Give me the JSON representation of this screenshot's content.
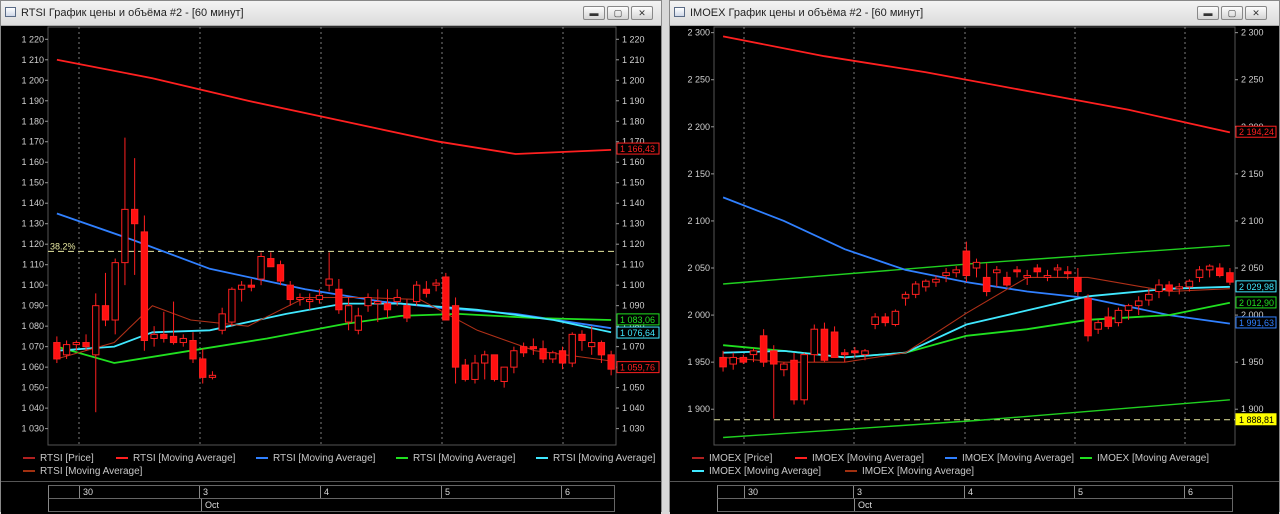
{
  "windows": [
    {
      "id": "rtsi",
      "title": "RTSI График цены и объёма #2 - [60 минут]",
      "y_ticks": [
        "1 220",
        "1 210",
        "1 200",
        "1 190",
        "1 180",
        "1 170",
        "1 160",
        "1 150",
        "1 140",
        "1 130",
        "1 120",
        "1 110",
        "1 100",
        "1 090",
        "1 080",
        "1 070",
        "1 060",
        "1 050",
        "1 040",
        "1 030"
      ],
      "y_range": [
        1022,
        1226
      ],
      "fib_label": "38.2%",
      "fib_value": 1116.5,
      "price_labels": [
        {
          "text": "1 166,43",
          "value": 1166.43,
          "color": "#ff2020"
        },
        {
          "text": "1 083,06",
          "value": 1083.06,
          "color": "#20e020"
        },
        {
          "text": "1 076,64",
          "value": 1076.64,
          "color": "#40e8ff"
        },
        {
          "text": "1 059,76",
          "value": 1059.76,
          "color": "#ff2020"
        }
      ],
      "legend": [
        {
          "label": "RTSI [Price]",
          "color": "#b02020"
        },
        {
          "label": "RTSI [Moving Average]",
          "color": "#ff2020"
        },
        {
          "label": "RTSI [Moving Average]",
          "color": "#3080ff"
        },
        {
          "label": "RTSI [Moving Average]",
          "color": "#20e020"
        },
        {
          "label": "RTSI [Moving Average]",
          "color": "#40e8ff"
        },
        {
          "label": "RTSI [Moving Average]",
          "color": "#a03010"
        }
      ],
      "x_days": [
        "30",
        "3",
        "4",
        "5",
        "6"
      ],
      "x_month": "Oct",
      "series": {
        "candles": [
          [
            1072,
            1075,
            1062,
            1064
          ],
          [
            1066,
            1073,
            1064,
            1071
          ],
          [
            1071,
            1073,
            1068,
            1072
          ],
          [
            1072,
            1076,
            1068,
            1070
          ],
          [
            1066,
            1096,
            1038,
            1090
          ],
          [
            1090,
            1106,
            1080,
            1083
          ],
          [
            1083,
            1113,
            1076,
            1111
          ],
          [
            1111,
            1172,
            1100,
            1137
          ],
          [
            1137,
            1162,
            1105,
            1130
          ],
          [
            1126,
            1134,
            1068,
            1073
          ],
          [
            1074,
            1080,
            1070,
            1076
          ],
          [
            1076,
            1087,
            1072,
            1074
          ],
          [
            1075,
            1092,
            1071,
            1072
          ],
          [
            1072,
            1076,
            1070,
            1074
          ],
          [
            1073,
            1077,
            1062,
            1064
          ],
          [
            1064,
            1069,
            1052,
            1055
          ],
          [
            1055,
            1058,
            1054,
            1056
          ],
          [
            1078,
            1089,
            1076,
            1086
          ],
          [
            1082,
            1099,
            1080,
            1098
          ],
          [
            1098,
            1102,
            1092,
            1100
          ],
          [
            1100,
            1103,
            1097,
            1099
          ],
          [
            1103,
            1116,
            1100,
            1114
          ],
          [
            1113,
            1116,
            1109,
            1109
          ],
          [
            1110,
            1112,
            1100,
            1102
          ],
          [
            1100,
            1102,
            1090,
            1093
          ],
          [
            1093,
            1096,
            1090,
            1094
          ],
          [
            1092,
            1096,
            1088,
            1093
          ],
          [
            1093,
            1098,
            1091,
            1095
          ],
          [
            1100,
            1116,
            1097,
            1103
          ],
          [
            1098,
            1103,
            1086,
            1088
          ],
          [
            1082,
            1094,
            1078,
            1090
          ],
          [
            1078,
            1089,
            1076,
            1085
          ],
          [
            1090,
            1096,
            1087,
            1094
          ],
          [
            1091,
            1098,
            1082,
            1092
          ],
          [
            1091,
            1098,
            1084,
            1088
          ],
          [
            1092,
            1098,
            1090,
            1094
          ],
          [
            1090,
            1093,
            1082,
            1084
          ],
          [
            1092,
            1102,
            1090,
            1100
          ],
          [
            1098,
            1102,
            1094,
            1096
          ],
          [
            1100,
            1103,
            1097,
            1101
          ],
          [
            1104,
            1106,
            1084,
            1083
          ],
          [
            1090,
            1094,
            1052,
            1060
          ],
          [
            1061,
            1064,
            1053,
            1054
          ],
          [
            1054,
            1066,
            1052,
            1062
          ],
          [
            1062,
            1068,
            1054,
            1066
          ],
          [
            1066,
            1066,
            1053,
            1054
          ],
          [
            1053,
            1058,
            1050,
            1060
          ],
          [
            1060,
            1070,
            1057,
            1068
          ],
          [
            1070,
            1072,
            1065,
            1067
          ],
          [
            1070,
            1074,
            1066,
            1069
          ],
          [
            1069,
            1073,
            1062,
            1064
          ],
          [
            1064,
            1068,
            1062,
            1067
          ],
          [
            1068,
            1070,
            1059,
            1062
          ],
          [
            1062,
            1077,
            1060,
            1076
          ],
          [
            1076,
            1078,
            1068,
            1073
          ],
          [
            1070,
            1080,
            1066,
            1072
          ],
          [
            1072,
            1073,
            1062,
            1066
          ],
          [
            1066,
            1068,
            1056,
            1059
          ]
        ],
        "ma_red": [
          [
            0,
            1210
          ],
          [
            10,
            1201
          ],
          [
            20,
            1190
          ],
          [
            30,
            1180
          ],
          [
            40,
            1170
          ],
          [
            48,
            1164
          ],
          [
            58,
            1166
          ]
        ],
        "ma_blue": [
          [
            0,
            1135
          ],
          [
            8,
            1122
          ],
          [
            16,
            1108
          ],
          [
            26,
            1098
          ],
          [
            34,
            1092
          ],
          [
            40,
            1089
          ],
          [
            48,
            1086
          ],
          [
            58,
            1079
          ]
        ],
        "ma_green": [
          [
            0,
            1070
          ],
          [
            6,
            1062
          ],
          [
            14,
            1068
          ],
          [
            22,
            1074
          ],
          [
            30,
            1081
          ],
          [
            36,
            1085
          ],
          [
            42,
            1086
          ],
          [
            50,
            1084
          ],
          [
            58,
            1083
          ]
        ],
        "ma_cyan": [
          [
            0,
            1068
          ],
          [
            6,
            1070
          ],
          [
            10,
            1077
          ],
          [
            16,
            1078
          ],
          [
            24,
            1086
          ],
          [
            30,
            1091
          ],
          [
            36,
            1091
          ],
          [
            44,
            1088
          ],
          [
            52,
            1083
          ],
          [
            58,
            1077
          ]
        ],
        "ma_dark": [
          [
            0,
            1064
          ],
          [
            6,
            1072
          ],
          [
            10,
            1090
          ],
          [
            14,
            1083
          ],
          [
            20,
            1080
          ],
          [
            26,
            1094
          ],
          [
            32,
            1094
          ],
          [
            38,
            1093
          ],
          [
            44,
            1078
          ],
          [
            50,
            1068
          ],
          [
            58,
            1063
          ]
        ]
      }
    },
    {
      "id": "imoex",
      "title": "IMOEX График цены и объёма #2 - [60 минут]",
      "y_ticks": [
        "2 300",
        "2 250",
        "2 200",
        "2 150",
        "2 100",
        "2 050",
        "2 000",
        "1 950",
        "1 900"
      ],
      "y_range": [
        1862,
        2306
      ],
      "fib_label": "",
      "fib_value": 1888.81,
      "price_labels": [
        {
          "text": "2 194,24",
          "value": 2194.24,
          "color": "#ff2020"
        },
        {
          "text": "2 029,98",
          "value": 2029.98,
          "color": "#40e8ff"
        },
        {
          "text": "2 012,90",
          "value": 2012.9,
          "color": "#20e020"
        },
        {
          "text": "1 991,63",
          "value": 1991.63,
          "color": "#3080ff"
        },
        {
          "text": "1 888,81",
          "value": 1888.81,
          "color": "#ffff00"
        }
      ],
      "legend": [
        {
          "label": "IMOEX [Price]",
          "color": "#b02020"
        },
        {
          "label": "IMOEX [Moving Average]",
          "color": "#ff2020"
        },
        {
          "label": "IMOEX [Moving Average]",
          "color": "#3080ff"
        },
        {
          "label": "IMOEX [Moving Average]",
          "color": "#20e020"
        },
        {
          "label": "IMOEX [Moving Average]",
          "color": "#40e8ff"
        },
        {
          "label": "IMOEX [Moving Average]",
          "color": "#a03010"
        }
      ],
      "x_days": [
        "30",
        "3",
        "4",
        "5",
        "6"
      ],
      "x_month": "Oct",
      "series": {
        "candles": [
          [
            1955,
            1962,
            1940,
            1945
          ],
          [
            1948,
            1960,
            1942,
            1955
          ],
          [
            1955,
            1958,
            1948,
            1950
          ],
          [
            1958,
            1965,
            1950,
            1962
          ],
          [
            1978,
            1985,
            1945,
            1950
          ],
          [
            1962,
            1968,
            1890,
            1948
          ],
          [
            1942,
            1950,
            1935,
            1948
          ],
          [
            1952,
            1960,
            1905,
            1910
          ],
          [
            1910,
            1960,
            1905,
            1958
          ],
          [
            1958,
            1990,
            1950,
            1985
          ],
          [
            1985,
            1992,
            1950,
            1952
          ],
          [
            1982,
            1988,
            1955,
            1955
          ],
          [
            1960,
            1964,
            1950,
            1958
          ],
          [
            1962,
            1966,
            1955,
            1960
          ],
          [
            1958,
            1964,
            1952,
            1962
          ],
          [
            1990,
            2002,
            1985,
            1998
          ],
          [
            1998,
            2002,
            1988,
            1992
          ],
          [
            1990,
            2006,
            1988,
            2004
          ],
          [
            2018,
            2025,
            2010,
            2022
          ],
          [
            2022,
            2036,
            2018,
            2033
          ],
          [
            2030,
            2038,
            2025,
            2036
          ],
          [
            2035,
            2042,
            2030,
            2038
          ],
          [
            2042,
            2050,
            2035,
            2045
          ],
          [
            2045,
            2052,
            2040,
            2048
          ],
          [
            2068,
            2078,
            2035,
            2042
          ],
          [
            2050,
            2060,
            2040,
            2056
          ],
          [
            2040,
            2055,
            2020,
            2025
          ],
          [
            2045,
            2052,
            2030,
            2048
          ],
          [
            2040,
            2046,
            2030,
            2032
          ],
          [
            2048,
            2052,
            2040,
            2046
          ],
          [
            2040,
            2048,
            2032,
            2042
          ],
          [
            2050,
            2054,
            2040,
            2046
          ],
          [
            2040,
            2048,
            2036,
            2042
          ],
          [
            2048,
            2054,
            2040,
            2050
          ],
          [
            2046,
            2052,
            2038,
            2044
          ],
          [
            2040,
            2050,
            2020,
            2025
          ],
          [
            2018,
            2022,
            1972,
            1978
          ],
          [
            1985,
            1995,
            1980,
            1992
          ],
          [
            1998,
            2008,
            1985,
            1988
          ],
          [
            1992,
            2008,
            1988,
            2005
          ],
          [
            2005,
            2012,
            1995,
            2010
          ],
          [
            2010,
            2020,
            2000,
            2015
          ],
          [
            2016,
            2028,
            2010,
            2022
          ],
          [
            2025,
            2038,
            2018,
            2032
          ],
          [
            2032,
            2036,
            2020,
            2026
          ],
          [
            2028,
            2034,
            2022,
            2030
          ],
          [
            2030,
            2038,
            2025,
            2036
          ],
          [
            2040,
            2052,
            2035,
            2048
          ],
          [
            2048,
            2054,
            2040,
            2052
          ],
          [
            2050,
            2055,
            2040,
            2042
          ],
          [
            2045,
            2050,
            2032,
            2035
          ]
        ],
        "ma_red": [
          [
            0,
            2296
          ],
          [
            10,
            2275
          ],
          [
            20,
            2258
          ],
          [
            30,
            2238
          ],
          [
            40,
            2218
          ],
          [
            50,
            2194
          ]
        ],
        "ma_blue": [
          [
            0,
            2125
          ],
          [
            6,
            2100
          ],
          [
            12,
            2070
          ],
          [
            18,
            2048
          ],
          [
            24,
            2035
          ],
          [
            30,
            2025
          ],
          [
            36,
            2018
          ],
          [
            44,
            2000
          ],
          [
            50,
            1991
          ]
        ],
        "ma_green_upper": [
          [
            0,
            2033
          ],
          [
            25,
            2055
          ],
          [
            50,
            2074
          ]
        ],
        "ma_green_lower": [
          [
            0,
            1870
          ],
          [
            25,
            1888
          ],
          [
            50,
            1910
          ]
        ],
        "ma_green": [
          [
            0,
            1968
          ],
          [
            6,
            1962
          ],
          [
            12,
            1955
          ],
          [
            18,
            1960
          ],
          [
            24,
            1978
          ],
          [
            30,
            1985
          ],
          [
            36,
            1995
          ],
          [
            44,
            2000
          ],
          [
            50,
            2013
          ]
        ],
        "ma_cyan": [
          [
            0,
            1960
          ],
          [
            6,
            1962
          ],
          [
            12,
            1955
          ],
          [
            18,
            1960
          ],
          [
            24,
            1990
          ],
          [
            30,
            2005
          ],
          [
            36,
            2020
          ],
          [
            44,
            2028
          ],
          [
            50,
            2030
          ]
        ],
        "ma_dark": [
          [
            0,
            1955
          ],
          [
            6,
            1950
          ],
          [
            12,
            1950
          ],
          [
            18,
            1960
          ],
          [
            24,
            2002
          ],
          [
            30,
            2040
          ],
          [
            36,
            2040
          ],
          [
            44,
            2025
          ],
          [
            50,
            2028
          ]
        ]
      }
    }
  ],
  "colors": {
    "grid": "#cfcfcf",
    "candle_up": "#ff1010",
    "candle_down": "#ff1010",
    "axis_text": "#d0d0d0"
  }
}
